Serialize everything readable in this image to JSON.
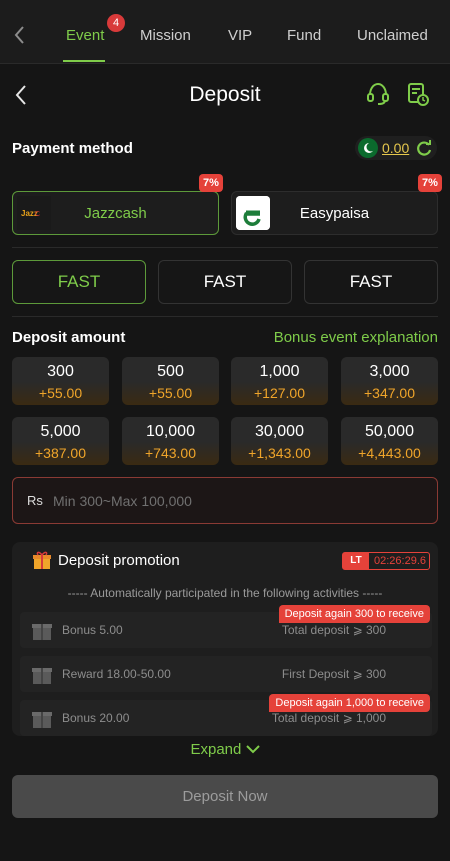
{
  "nav": {
    "tabs": [
      {
        "label": "Event",
        "badge": "4"
      },
      {
        "label": "Mission"
      },
      {
        "label": "VIP"
      },
      {
        "label": "Fund"
      },
      {
        "label": "Unclaimed"
      }
    ],
    "active_tab": "Event",
    "accent_color": "#7fcc4a"
  },
  "header": {
    "title": "Deposit",
    "icons": [
      "back-icon",
      "headset-icon",
      "record-icon"
    ]
  },
  "payment": {
    "label": "Payment method",
    "balance": "0.00",
    "methods": [
      {
        "name": "Jazzcash",
        "bonus_pct": "7%",
        "selected": true
      },
      {
        "name": "Easypaisa",
        "bonus_pct": "7%",
        "selected": false
      }
    ],
    "channels": [
      "FAST",
      "FAST",
      "FAST"
    ]
  },
  "deposit": {
    "label": "Deposit amount",
    "bonus_link": "Bonus event explanation",
    "amounts": [
      {
        "value": "300",
        "bonus": "+55.00"
      },
      {
        "value": "500",
        "bonus": "+55.00"
      },
      {
        "value": "1,000",
        "bonus": "+127.00"
      },
      {
        "value": "3,000",
        "bonus": "+347.00"
      },
      {
        "value": "5,000",
        "bonus": "+387.00"
      },
      {
        "value": "10,000",
        "bonus": "+743.00"
      },
      {
        "value": "30,000",
        "bonus": "+1,343.00"
      },
      {
        "value": "50,000",
        "bonus": "+4,443.00"
      }
    ],
    "currency": "Rs",
    "placeholder": "Min 300~Max 100,000"
  },
  "promotion": {
    "title": "Deposit promotion",
    "lt_label": "LT",
    "timer": "02:26:29.6",
    "auto_text": "----- Automatically participated in the following activities -----",
    "activities": [
      {
        "title": "Bonus 5.00",
        "condition": "Total deposit ⩾ 300",
        "tip": "Deposit again 300 to receive"
      },
      {
        "title": "Reward 18.00-50.00",
        "condition": "First Deposit ⩾ 300",
        "tip": ""
      },
      {
        "title": "Bonus 20.00",
        "condition": "Total deposit ⩾ 1,000",
        "tip": "Deposit again 1,000 to receive"
      }
    ],
    "expand_label": "Expand"
  },
  "submit": {
    "label": "Deposit Now"
  }
}
